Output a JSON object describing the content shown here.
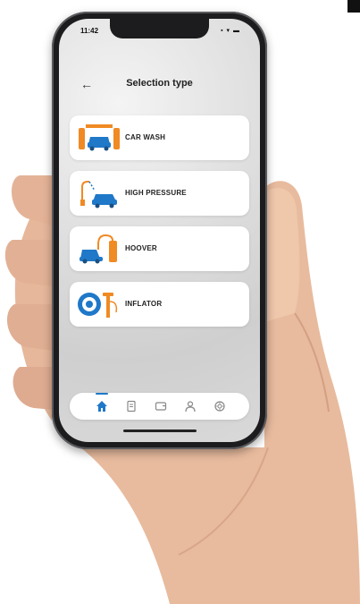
{
  "status": {
    "time": "11:42",
    "icons": "▪ ▾ ▬"
  },
  "header": {
    "back_icon": "arrow-left-icon",
    "title": "Selection type"
  },
  "options": [
    {
      "label": "CAR WASH",
      "icon": "car-wash-icon"
    },
    {
      "label": "HIGH PRESSURE",
      "icon": "high-pressure-icon"
    },
    {
      "label": "HOOVER",
      "icon": "hoover-icon"
    },
    {
      "label": "INFLATOR",
      "icon": "inflator-icon"
    }
  ],
  "nav": [
    {
      "icon": "home-icon",
      "active": true
    },
    {
      "icon": "document-icon",
      "active": false
    },
    {
      "icon": "wallet-icon",
      "active": false
    },
    {
      "icon": "user-icon",
      "active": false
    },
    {
      "icon": "settings-icon",
      "active": false
    }
  ],
  "colors": {
    "accent_blue": "#1f78c8",
    "accent_orange": "#f08a24",
    "card_bg": "#ffffff",
    "text": "#222222"
  }
}
